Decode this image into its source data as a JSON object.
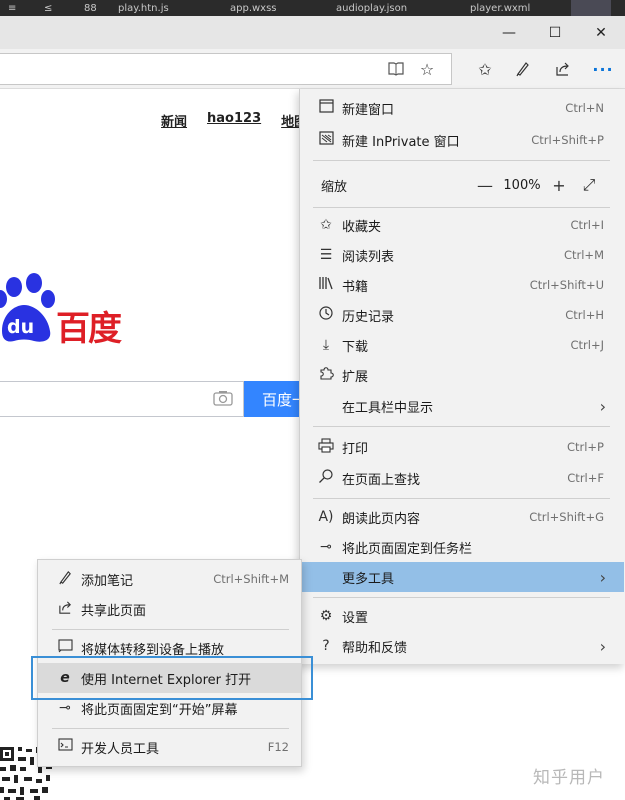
{
  "taskbar": {
    "items": [
      "≡",
      "≤",
      "88",
      "play.htn.js",
      "app.wxss",
      "audioplay.json",
      "player.wxml"
    ]
  },
  "window": {
    "minimize": "—",
    "maximize": "☐",
    "close": "✕"
  },
  "toolbar": {
    "reading_view_icon": "book-icon",
    "favorite_icon": "star-icon",
    "more_label": "···"
  },
  "page": {
    "top_links": [
      "新闻",
      "hao123",
      "地图"
    ],
    "logo_text": "百度",
    "logo_badge": "du",
    "search_button": "百度一下",
    "watermark": "知乎用户"
  },
  "menu": {
    "new_window": {
      "label": "新建窗口",
      "shortcut": "Ctrl+N"
    },
    "new_inprivate": {
      "label": "新建 InPrivate 窗口",
      "shortcut": "Ctrl+Shift+P"
    },
    "zoom": {
      "label": "缩放",
      "minus": "—",
      "value": "100%",
      "plus": "+",
      "fullscreen": "⤢"
    },
    "favorites": {
      "label": "收藏夹",
      "shortcut": "Ctrl+I"
    },
    "reading_list": {
      "label": "阅读列表",
      "shortcut": "Ctrl+M"
    },
    "books": {
      "label": "书籍",
      "shortcut": "Ctrl+Shift+U"
    },
    "history": {
      "label": "历史记录",
      "shortcut": "Ctrl+H"
    },
    "downloads": {
      "label": "下载",
      "shortcut": "Ctrl+J"
    },
    "extensions": {
      "label": "扩展"
    },
    "show_in_toolbar": {
      "label": "在工具栏中显示"
    },
    "print": {
      "label": "打印",
      "shortcut": "Ctrl+P"
    },
    "find": {
      "label": "在页面上查找",
      "shortcut": "Ctrl+F"
    },
    "read_aloud": {
      "label": "朗读此页内容",
      "shortcut": "Ctrl+Shift+G"
    },
    "pin_taskbar": {
      "label": "将此页面固定到任务栏"
    },
    "more_tools": {
      "label": "更多工具"
    },
    "settings": {
      "label": "设置"
    },
    "help": {
      "label": "帮助和反馈"
    }
  },
  "submenu": {
    "add_notes": {
      "label": "添加笔记",
      "shortcut": "Ctrl+Shift+M"
    },
    "share": {
      "label": "共享此页面"
    },
    "cast": {
      "label": "将媒体转移到设备上播放"
    },
    "open_ie": {
      "label": "使用 Internet Explorer 打开"
    },
    "pin_start": {
      "label": "将此页面固定到“开始”屏幕"
    },
    "dev_tools": {
      "label": "开发人员工具",
      "shortcut": "F12"
    }
  },
  "colors": {
    "menu_bg": "#f2f2f2",
    "active_item": "#93bfe7",
    "highlight_border": "#3a8fd6",
    "baidu_red": "#de1f26",
    "baidu_blue": "#2932e1",
    "search_button": "#3385ff"
  }
}
